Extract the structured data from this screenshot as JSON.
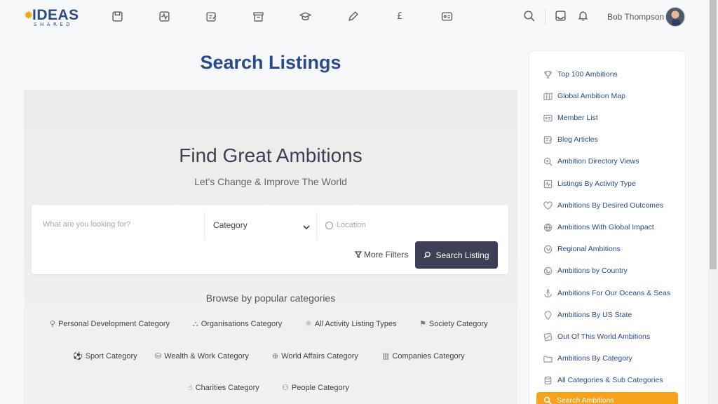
{
  "brand": {
    "logo_word": "IDEAS",
    "logo_sub": "SHARED",
    "accent": "#2b4a8c",
    "highlight": "#f7a21b",
    "dark_button": "#3d4054"
  },
  "topnav": {
    "icons": [
      "listings-icon",
      "activity-icon",
      "edit-icon",
      "archive-icon",
      "graduation-icon",
      "pencil-icon",
      "pound-icon",
      "id-card-icon"
    ],
    "pound_glyph": "£",
    "user_name": "Bob Thompson"
  },
  "main": {
    "page_title": "Search Listings",
    "hero_title": "Find Great Ambitions",
    "hero_tagline": "Let's Change & Improve The World",
    "search": {
      "placeholder": "What are you looking for?",
      "category_value": "Category",
      "location_placeholder": "Location",
      "more_filters": "More Filters",
      "search_button": "Search Listing"
    },
    "browse_heading": "Browse by popular categories",
    "categories": [
      {
        "label": "Personal Development Category",
        "icon": "key-icon"
      },
      {
        "label": "Organisations Category",
        "icon": "org-icon"
      },
      {
        "label": "All Activity Listing Types",
        "icon": "atom-icon"
      },
      {
        "label": "Society Category",
        "icon": "flag-icon"
      },
      {
        "label": "Sport Category",
        "icon": "ball-icon"
      },
      {
        "label": "Wealth & Work Category",
        "icon": "coins-icon"
      },
      {
        "label": "World Affairs Category",
        "icon": "globe-icon"
      },
      {
        "label": "Companies Category",
        "icon": "building-icon"
      },
      {
        "label": "Charities Category",
        "icon": "hand-icon"
      },
      {
        "label": "People Category",
        "icon": "people-icon"
      }
    ]
  },
  "sidebar": {
    "items": [
      {
        "label": "Top 100 Ambitions",
        "icon": "trophy-icon"
      },
      {
        "label": "Global Ambition Map",
        "icon": "map-icon"
      },
      {
        "label": "Member List",
        "icon": "id-card-icon"
      },
      {
        "label": "Blog Articles",
        "icon": "edit-icon"
      },
      {
        "label": "Ambition Directory Views",
        "icon": "zoom-icon"
      },
      {
        "label": "Listings By Activity Type",
        "icon": "activity-icon"
      },
      {
        "label": "Ambitions By Desired Outcomes",
        "icon": "heart-icon"
      },
      {
        "label": "Ambitions With Global Impact",
        "icon": "globe-icon"
      },
      {
        "label": "Regional Ambitions",
        "icon": "region-icon"
      },
      {
        "label": "Ambitions by Country",
        "icon": "earth-icon"
      },
      {
        "label": "Ambitions For Our Oceans & Seas",
        "icon": "anchor-icon"
      },
      {
        "label": "Ambitions By US State",
        "icon": "pin-icon"
      },
      {
        "label": "Out Of This World Ambitions",
        "icon": "planet-icon"
      },
      {
        "label": "Ambitions By Category",
        "icon": "folder-icon"
      },
      {
        "label": "All Categories & Sub Categories",
        "icon": "database-icon"
      }
    ],
    "active_item": "Search Ambitions"
  }
}
